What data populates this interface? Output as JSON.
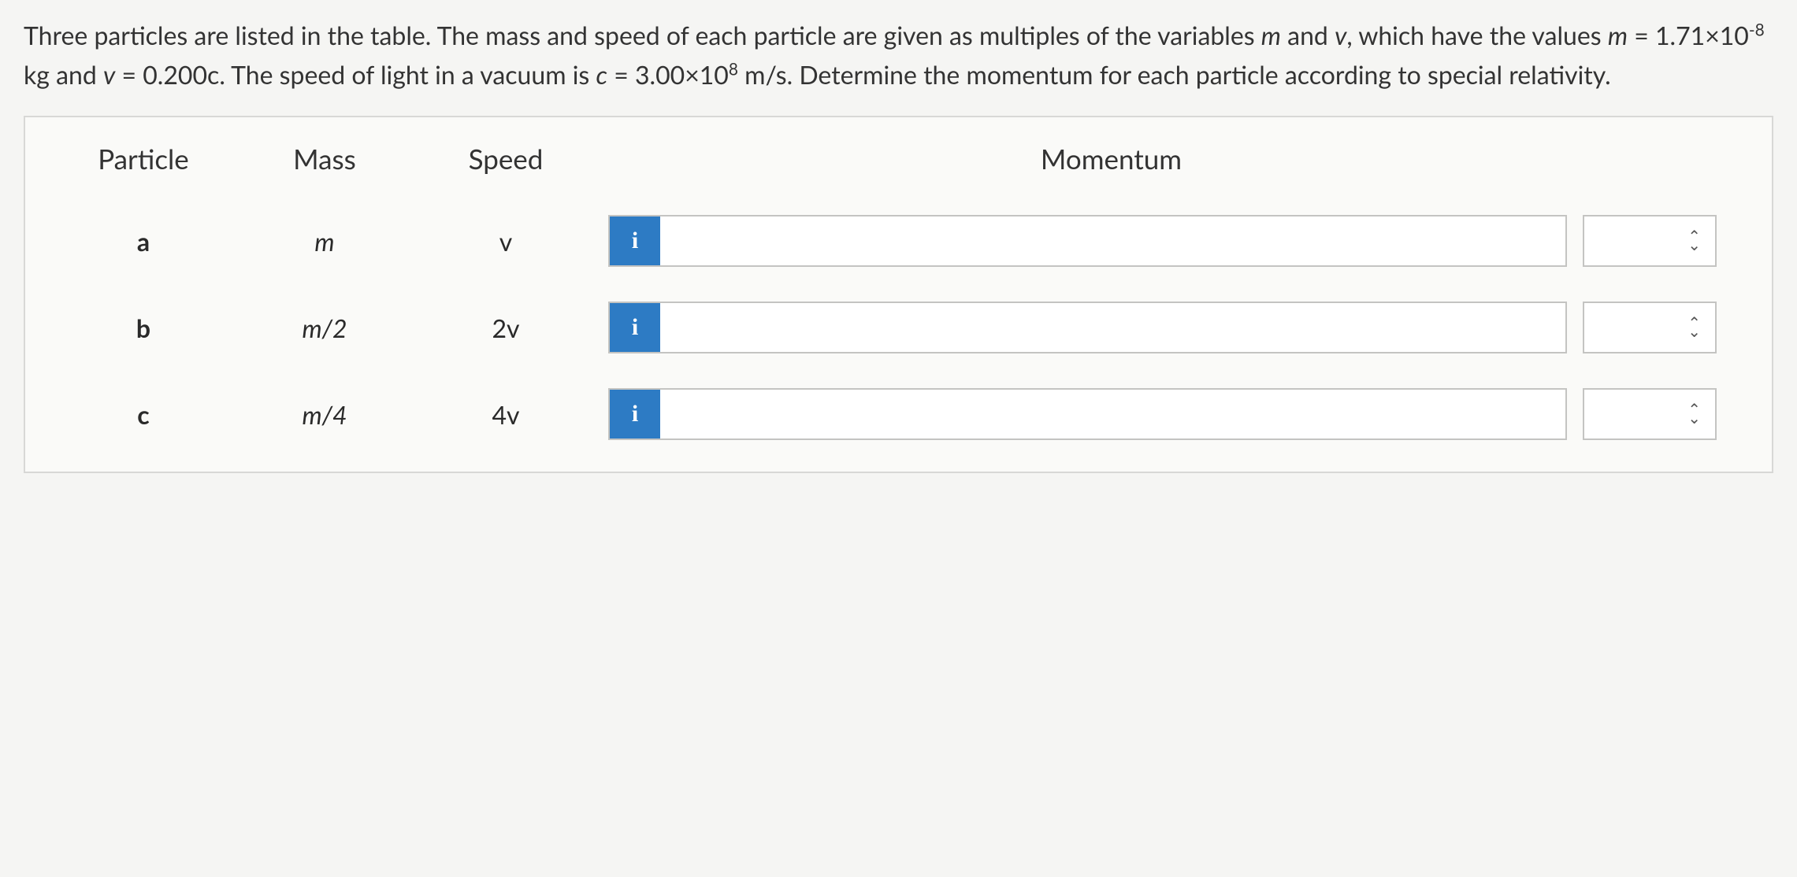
{
  "question": {
    "text_pre": "Three particles are listed in the table. The mass and speed of each particle are given as multiples of the variables ",
    "var_m": "m",
    "text_and1": " and ",
    "var_v": "v",
    "text_values": ", which have the values ",
    "m_eq": "m",
    "equals1": " = 1.71×10",
    "exp1": "-8",
    "kg_and": " kg and ",
    "v_eq": "v",
    "equals2": " = 0.200c. The speed of light in a vacuum is ",
    "c_eq": "c",
    "equals3": " = 3.00×10",
    "exp2": "8",
    "ms_rest": " m/s. Determine the momentum for each particle according to special relativity."
  },
  "headers": {
    "particle": "Particle",
    "mass": "Mass",
    "speed": "Speed",
    "momentum": "Momentum"
  },
  "icons": {
    "info": "i"
  },
  "rows": [
    {
      "particle": "a",
      "mass": "m",
      "speed": "v",
      "momentum": ""
    },
    {
      "particle": "b",
      "mass": "m/2",
      "speed": "2v",
      "momentum": ""
    },
    {
      "particle": "c",
      "mass": "m/4",
      "speed": "4v",
      "momentum": ""
    }
  ]
}
